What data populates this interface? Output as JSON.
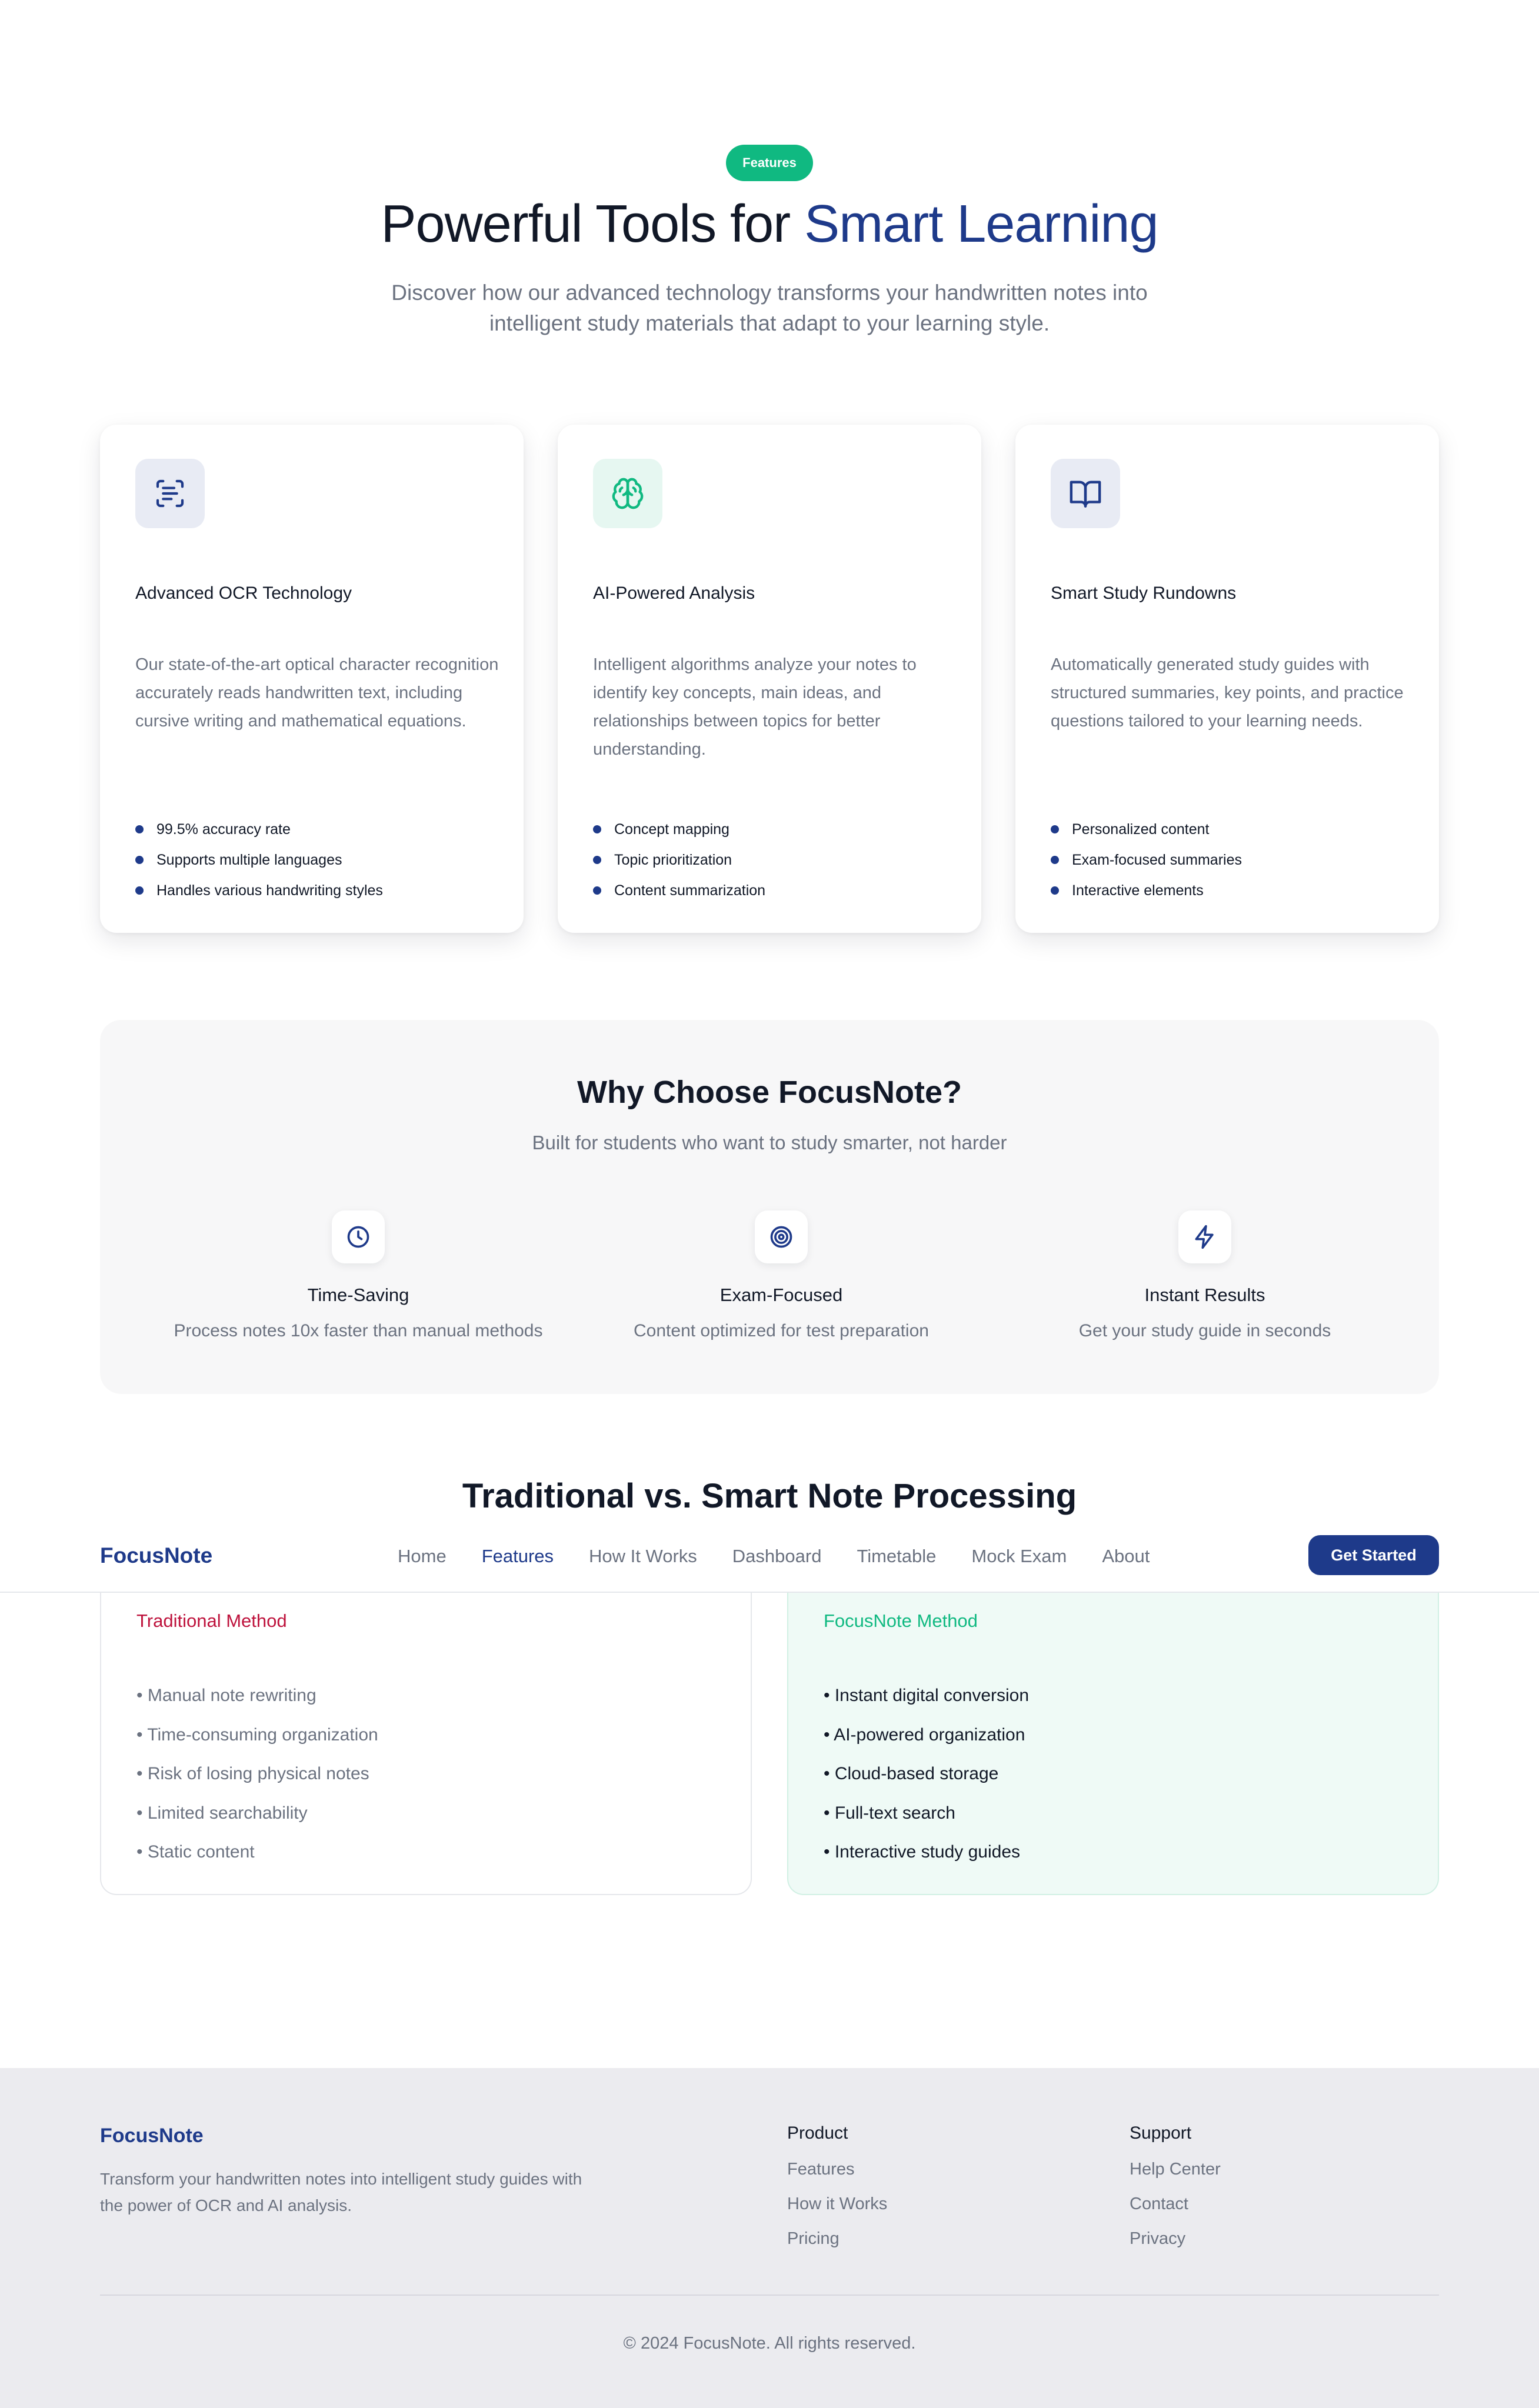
{
  "hero": {
    "badge": "Features",
    "title_part1": "Powerful Tools for ",
    "title_part2": "Smart Learning",
    "subtitle": "Discover how our advanced technology transforms your handwritten notes into intelligent study materials that adapt to your learning style."
  },
  "features": [
    {
      "icon": "scan-text-icon",
      "title": "Advanced OCR Technology",
      "description": "Our state-of-the-art optical character recognition accurately reads handwritten text, including cursive writing and mathematical equations.",
      "bullets": [
        "99.5% accuracy rate",
        "Supports multiple languages",
        "Handles various handwriting styles"
      ]
    },
    {
      "icon": "brain-icon",
      "title": "AI-Powered Analysis",
      "description": "Intelligent algorithms analyze your notes to identify key concepts, main ideas, and relationships between topics for better understanding.",
      "bullets": [
        "Concept mapping",
        "Topic prioritization",
        "Content summarization"
      ]
    },
    {
      "icon": "book-open-icon",
      "title": "Smart Study Rundowns",
      "description": "Automatically generated study guides with structured summaries, key points, and practice questions tailored to your learning needs.",
      "bullets": [
        "Personalized content",
        "Exam-focused summaries",
        "Interactive elements"
      ]
    }
  ],
  "why": {
    "title": "Why Choose FocusNote?",
    "subtitle": "Built for students who want to study smarter, not harder",
    "items": [
      {
        "icon": "clock-icon",
        "title": "Time-Saving",
        "desc": "Process notes 10x faster than manual methods"
      },
      {
        "icon": "target-icon",
        "title": "Exam-Focused",
        "desc": "Content optimized for test preparation"
      },
      {
        "icon": "zap-icon",
        "title": "Instant Results",
        "desc": "Get your study guide in seconds"
      }
    ]
  },
  "compare": {
    "title": "Traditional vs. Smart Note Processing",
    "traditional": {
      "heading": "Traditional Method",
      "items": [
        "• Manual note rewriting",
        "• Time-consuming organization",
        "• Risk of losing physical notes",
        "• Limited searchability",
        "• Static content"
      ]
    },
    "smart": {
      "heading": "FocusNote Method",
      "items": [
        "• Instant digital conversion",
        "• AI-powered organization",
        "• Cloud-based storage",
        "• Full-text search",
        "• Interactive study guides"
      ]
    }
  },
  "nav": {
    "logo": "FocusNote",
    "links": [
      "Home",
      "Features",
      "How It Works",
      "Dashboard",
      "Timetable",
      "Mock Exam",
      "About"
    ],
    "active": "Features",
    "cta": "Get Started"
  },
  "footer": {
    "logo": "FocusNote",
    "description": "Transform your handwritten notes into intelligent study guides with the power of OCR and AI analysis.",
    "product": {
      "heading": "Product",
      "links": [
        "Features",
        "How it Works",
        "Pricing"
      ]
    },
    "support": {
      "heading": "Support",
      "links": [
        "Help Center",
        "Contact",
        "Privacy"
      ]
    },
    "copyright": "© 2024 FocusNote. All rights reserved."
  },
  "colors": {
    "brand": "#1e3a8a",
    "accent_green": "#10b981",
    "traditional_red": "#be123c",
    "muted_text": "#6b7280"
  }
}
